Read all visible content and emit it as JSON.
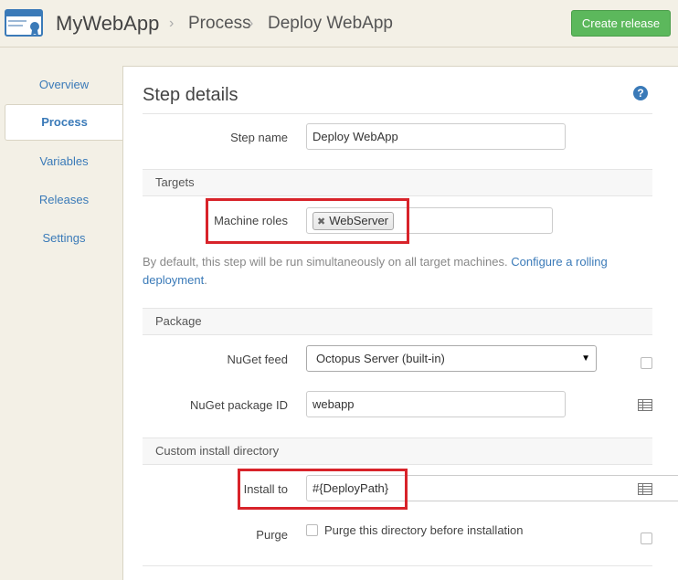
{
  "header": {
    "app_name": "MyWebApp",
    "breadcrumb": [
      "Process",
      "Deploy WebApp"
    ],
    "create_release_label": "Create release"
  },
  "sidebar": {
    "items": [
      {
        "label": "Overview",
        "active": false
      },
      {
        "label": "Process",
        "active": true
      },
      {
        "label": "Variables",
        "active": false
      },
      {
        "label": "Releases",
        "active": false
      },
      {
        "label": "Settings",
        "active": false
      }
    ]
  },
  "panel": {
    "title": "Step details",
    "help_icon": "?",
    "step_name_label": "Step name",
    "step_name_value": "Deploy WebApp",
    "targets": {
      "heading": "Targets",
      "machine_roles_label": "Machine roles",
      "role_tag": "WebServer",
      "hint_text": "By default, this step will be run simultaneously on all target machines.",
      "hint_link": "Configure a rolling deployment",
      "hint_end": "."
    },
    "package": {
      "heading": "Package",
      "nuget_feed_label": "NuGet feed",
      "nuget_feed_value": "Octopus Server (built-in)",
      "package_id_label": "NuGet package ID",
      "package_id_value": "webapp"
    },
    "install": {
      "heading": "Custom install directory",
      "install_to_label": "Install to",
      "install_to_value": "#{DeployPath}",
      "purge_label": "Purge",
      "purge_checkbox_label": "Purge this directory before installation"
    }
  },
  "colors": {
    "accent": "#3a7ab8",
    "create_button": "#5cb85c",
    "highlight": "#d8232a"
  }
}
